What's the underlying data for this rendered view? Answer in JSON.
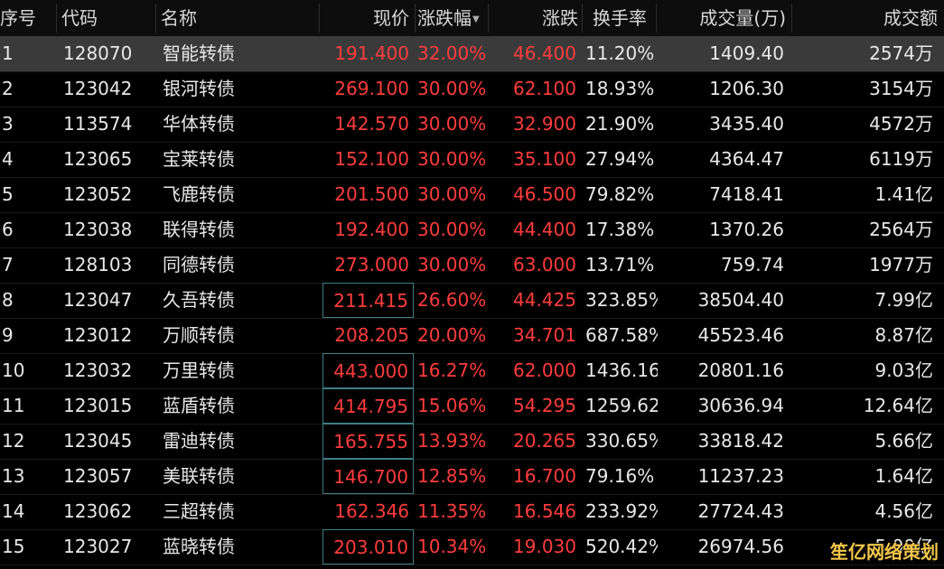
{
  "header": {
    "seq": "序号",
    "code": "代码",
    "name": "名称",
    "price": "现价",
    "pct": "涨跌幅",
    "chg": "涨跌",
    "turnover": "换手率",
    "volume": "成交量(万)",
    "amount": "成交额"
  },
  "rows": [
    {
      "seq": "1",
      "code": "128070",
      "name": "智能转债",
      "price": "191.400",
      "pct": "32.00%",
      "chg": "46.400",
      "turnover": "11.20%",
      "volume": "1409.40",
      "amount": "2574万"
    },
    {
      "seq": "2",
      "code": "123042",
      "name": "银河转债",
      "price": "269.100",
      "pct": "30.00%",
      "chg": "62.100",
      "turnover": "18.93%",
      "volume": "1206.30",
      "amount": "3154万"
    },
    {
      "seq": "3",
      "code": "113574",
      "name": "华体转债",
      "price": "142.570",
      "pct": "30.00%",
      "chg": "32.900",
      "turnover": "21.90%",
      "volume": "3435.40",
      "amount": "4572万"
    },
    {
      "seq": "4",
      "code": "123065",
      "name": "宝莱转债",
      "price": "152.100",
      "pct": "30.00%",
      "chg": "35.100",
      "turnover": "27.94%",
      "volume": "4364.47",
      "amount": "6119万"
    },
    {
      "seq": "5",
      "code": "123052",
      "name": "飞鹿转债",
      "price": "201.500",
      "pct": "30.00%",
      "chg": "46.500",
      "turnover": "79.82%",
      "volume": "7418.41",
      "amount": "1.41亿"
    },
    {
      "seq": "6",
      "code": "123038",
      "name": "联得转债",
      "price": "192.400",
      "pct": "30.00%",
      "chg": "44.400",
      "turnover": "17.38%",
      "volume": "1370.26",
      "amount": "2564万"
    },
    {
      "seq": "7",
      "code": "128103",
      "name": "同德转债",
      "price": "273.000",
      "pct": "30.00%",
      "chg": "63.000",
      "turnover": "13.71%",
      "volume": "759.74",
      "amount": "1977万"
    },
    {
      "seq": "8",
      "code": "123047",
      "name": "久吾转债",
      "price": "211.415",
      "pct": "26.60%",
      "chg": "44.425",
      "turnover": "323.85%",
      "volume": "38504.40",
      "amount": "7.99亿"
    },
    {
      "seq": "9",
      "code": "123012",
      "name": "万顺转债",
      "price": "208.205",
      "pct": "20.00%",
      "chg": "34.701",
      "turnover": "687.58%",
      "volume": "45523.46",
      "amount": "8.87亿"
    },
    {
      "seq": "10",
      "code": "123032",
      "name": "万里转债",
      "price": "443.000",
      "pct": "16.27%",
      "chg": "62.000",
      "turnover": "1436.16",
      "volume": "20801.16",
      "amount": "9.03亿"
    },
    {
      "seq": "11",
      "code": "123015",
      "name": "蓝盾转债",
      "price": "414.795",
      "pct": "15.06%",
      "chg": "54.295",
      "turnover": "1259.62",
      "volume": "30636.94",
      "amount": "12.64亿"
    },
    {
      "seq": "12",
      "code": "123045",
      "name": "雷迪转债",
      "price": "165.755",
      "pct": "13.93%",
      "chg": "20.265",
      "turnover": "330.65%",
      "volume": "33818.42",
      "amount": "5.66亿"
    },
    {
      "seq": "13",
      "code": "123057",
      "name": "美联转债",
      "price": "146.700",
      "pct": "12.85%",
      "chg": "16.700",
      "turnover": "79.16%",
      "volume": "11237.23",
      "amount": "1.64亿"
    },
    {
      "seq": "14",
      "code": "123062",
      "name": "三超转债",
      "price": "162.346",
      "pct": "11.35%",
      "chg": "16.546",
      "turnover": "233.92%",
      "volume": "27724.43",
      "amount": "4.56亿"
    },
    {
      "seq": "15",
      "code": "123027",
      "name": "蓝晓转债",
      "price": "203.010",
      "pct": "10.34%",
      "chg": "19.030",
      "turnover": "520.42%",
      "volume": "26974.56",
      "amount": "5.00亿"
    }
  ],
  "watermark": "笙亿网络策划",
  "colors": {
    "up": "#ff3c3c",
    "text": "#e8e8e8",
    "background": "#000000",
    "selected_row": "#3a3a3a",
    "price_box": "#3f7d87"
  }
}
